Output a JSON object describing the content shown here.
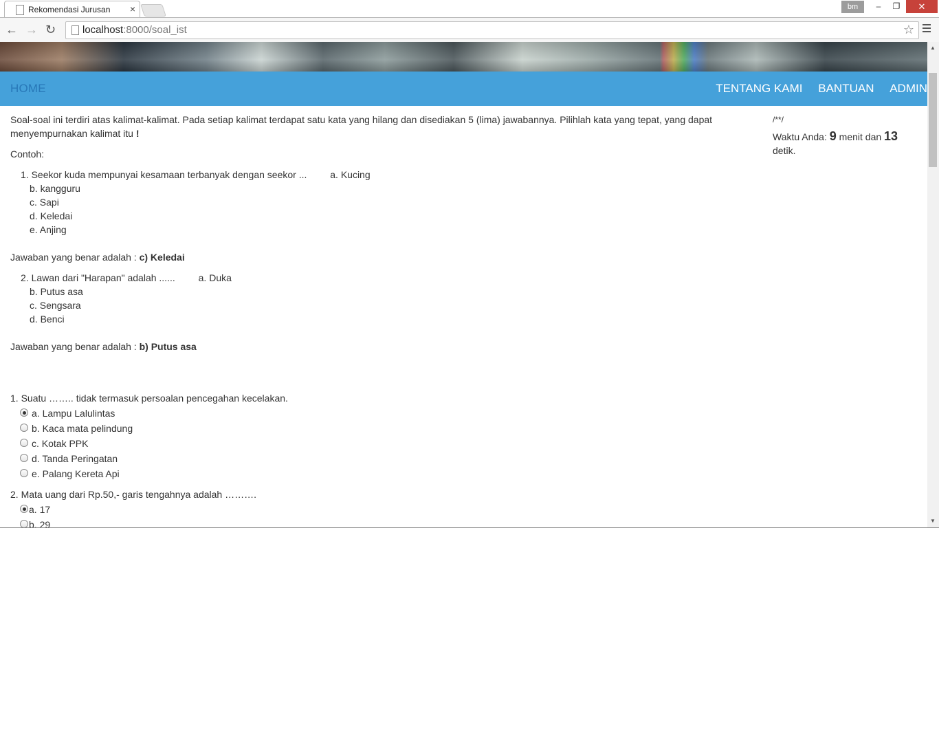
{
  "browser": {
    "tab_title": "Rekomendasi Jurusan",
    "tab_close": "×",
    "user_badge": "bm",
    "minimize": "–",
    "restore": "❐",
    "close": "✕",
    "back": "←",
    "forward": "→",
    "reload": "↻",
    "url_host": "localhost",
    "url_path": ":8000/soal_ist",
    "star": "☆"
  },
  "navbar": {
    "home": "HOME",
    "items": [
      "TENTANG KAMI",
      "BANTUAN",
      "ADMIN"
    ]
  },
  "instructions": {
    "text": "Soal-soal ini terdiri atas kalimat-kalimat. Pada setiap kalimat terdapat satu kata yang hilang dan disediakan 5 (lima) jawabannya. Pilihlah kata yang tepat, yang dapat menyempurnakan kalimat itu",
    "end_mark": "!",
    "example_label": "Contoh:"
  },
  "examples": [
    {
      "question": "1. Seekor kuda mempunyai kesamaan terbanyak dengan seekor ...",
      "first_option": "a. Kucing",
      "options": [
        "b. kangguru",
        "c. Sapi",
        "d. Keledai",
        "e. Anjing"
      ],
      "answer_prefix": "Jawaban yang benar adalah :",
      "answer": "c) Keledai"
    },
    {
      "question": "2. Lawan dari \"Harapan\" adalah ......",
      "first_option": "a. Duka",
      "options": [
        "b. Putus asa",
        "c. Sengsara",
        "d. Benci"
      ],
      "answer_prefix": "Jawaban yang benar adalah :",
      "answer": "b) Putus asa"
    }
  ],
  "questions": [
    {
      "text": "1. Suatu …….. tidak termasuk persoalan pencegahan kecelakan.",
      "options": [
        {
          "label": "a. Lampu Lalulintas",
          "checked": true
        },
        {
          "label": "b. Kaca mata pelindung",
          "checked": false
        },
        {
          "label": "c. Kotak PPK",
          "checked": false
        },
        {
          "label": "d. Tanda Peringatan",
          "checked": false
        },
        {
          "label": "e. Palang Kereta Api",
          "checked": false
        }
      ]
    },
    {
      "text": "2. Mata uang dari Rp.50,- garis tengahnya adalah ……….",
      "options": [
        {
          "label": "a. 17",
          "checked": true
        },
        {
          "label": "b. 29",
          "checked": false
        }
      ]
    }
  ],
  "timer": {
    "code": "/**/",
    "prefix": "Waktu Anda:",
    "minutes": "9",
    "mid": "menit dan",
    "seconds": "13",
    "suffix": "detik."
  }
}
